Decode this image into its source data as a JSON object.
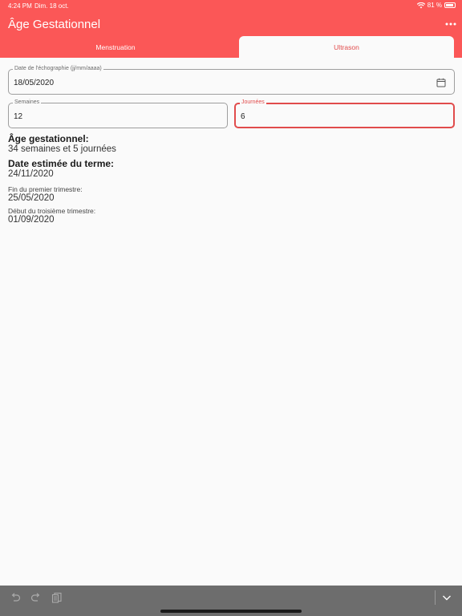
{
  "status": {
    "time": "4:24 PM",
    "date": "Dim. 18 oct.",
    "battery": "81 %"
  },
  "app": {
    "title": "Âge Gestationnel",
    "accent": "#fb5757"
  },
  "tabs": [
    {
      "label": "Menstruation"
    },
    {
      "label": "Ultrason"
    }
  ],
  "form": {
    "date": {
      "label": "Date de l'échographie (jj/mm/aaaa)",
      "value": "18/05/2020"
    },
    "weeks": {
      "label": "Semaines",
      "value": "12"
    },
    "days": {
      "label": "Journées",
      "value": "6"
    }
  },
  "results": {
    "ga_heading": "Âge gestationnel:",
    "ga_value": "34 semaines et 5 journées",
    "due_heading": "Date estimée du terme:",
    "due_value": "24/11/2020",
    "t1_label": "Fin du premier trimestre:",
    "t1_value": "25/05/2020",
    "t3_label": "Début du troisième trimestre:",
    "t3_value": "01/09/2020"
  },
  "icons": [
    "wifi-icon",
    "battery-icon",
    "moon-icon",
    "more-icon",
    "calendar-icon",
    "undo-icon",
    "redo-icon",
    "clipboard-icon",
    "chevron-down-icon"
  ]
}
